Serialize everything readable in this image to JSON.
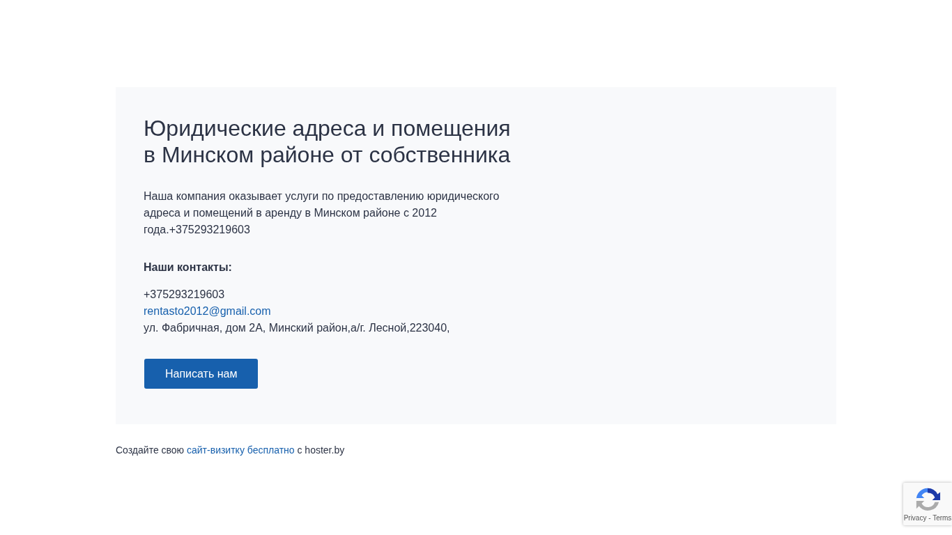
{
  "card": {
    "title": "Юридические адреса и помещения в Минском районе от собственника",
    "description": "Наша компания оказывает услуги по предоставлению юридического адреса и помещений в аренду в Минском районе с 2012 года.+375293219603",
    "contacts_heading": "Наши контакты:",
    "contacts": [
      {
        "kind": "text",
        "text": "+375293219603"
      },
      {
        "kind": "link",
        "text": "rentasto2012@gmail.com"
      },
      {
        "kind": "text",
        "text": "ул. Фабричная, дом 2А, Минский район,а/г. Лесной,223040,"
      }
    ],
    "button": "Написать нам"
  },
  "footer": {
    "before": "Создайте свою",
    "link": "сайт-визитку бесплатно",
    "after": "с hoster.by"
  },
  "recaptcha": {
    "links": "Privacy - Terms"
  }
}
